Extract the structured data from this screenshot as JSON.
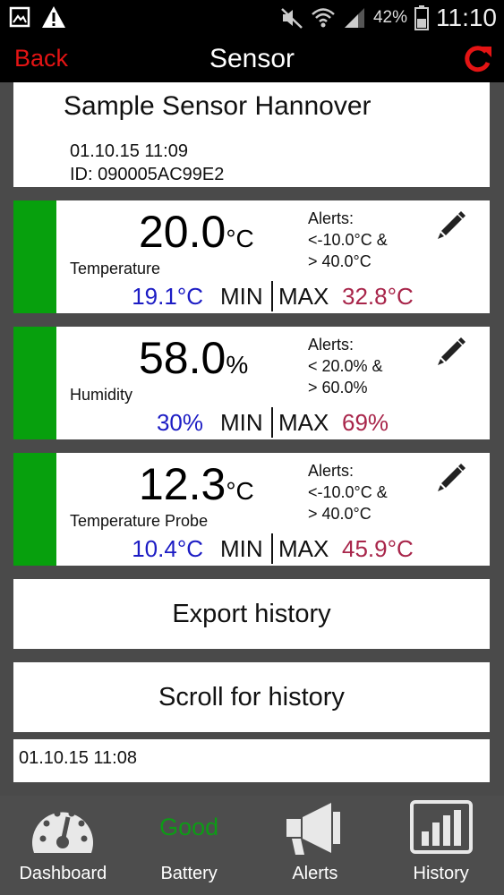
{
  "status_bar": {
    "battery_percent": "42%",
    "time": "11:10"
  },
  "nav": {
    "back_label": "Back",
    "title": "Sensor"
  },
  "sensor": {
    "name": "Sample Sensor Hannover",
    "date": "01.10.15  11:09",
    "id": "ID: 090005AC99E2"
  },
  "min_label": "MIN",
  "max_label": "MAX",
  "readings": [
    {
      "value": "20.0",
      "unit": "°C",
      "label": "Temperature",
      "alerts_title": "Alerts:",
      "alert_low": "<-10.0°C &",
      "alert_high": "> 40.0°C",
      "min": "19.1°C",
      "max": "32.8°C"
    },
    {
      "value": "58.0",
      "unit": "%",
      "label": "Humidity",
      "alerts_title": "Alerts:",
      "alert_low": "< 20.0% &",
      "alert_high": "> 60.0%",
      "min": "30%",
      "max": "69%"
    },
    {
      "value": "12.3",
      "unit": "°C",
      "label": "Temperature Probe",
      "alerts_title": "Alerts:",
      "alert_low": "<-10.0°C &",
      "alert_high": "> 40.0°C",
      "min": "10.4°C",
      "max": "45.9°C"
    }
  ],
  "actions": {
    "export_label": "Export history",
    "scroll_label": "Scroll for history"
  },
  "history": {
    "first_entry": "01.10.15  11:08"
  },
  "tabs": {
    "dashboard": "Dashboard",
    "battery": "Battery",
    "battery_status": "Good",
    "alerts": "Alerts",
    "history": "History"
  },
  "colors": {
    "accent_red": "#e41414",
    "status_green": "#07a00d",
    "min_blue": "#1c1cc4",
    "max_red": "#a8254a"
  },
  "icons": [
    "image-icon",
    "warning-icon",
    "mute-icon",
    "wifi-icon",
    "signal-icon",
    "battery-icon",
    "refresh-icon",
    "pencil-icon",
    "gauge-icon",
    "megaphone-icon",
    "bar-chart-icon"
  ]
}
